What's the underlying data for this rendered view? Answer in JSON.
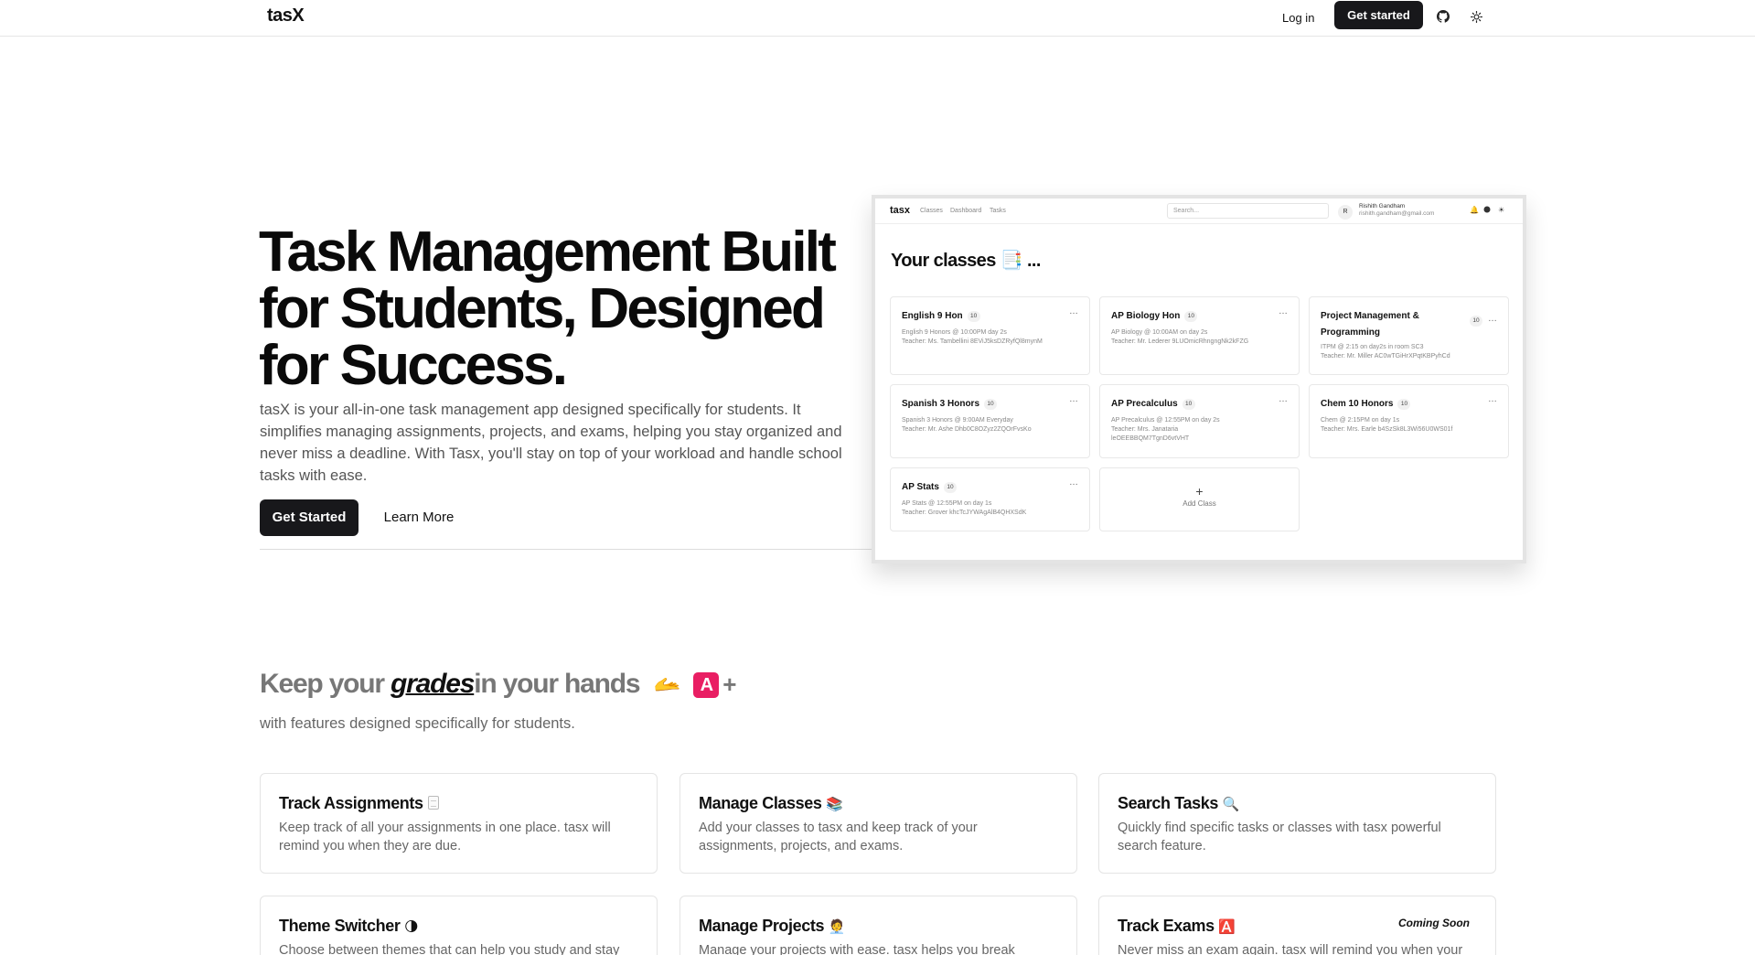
{
  "nav": {
    "brand": "tasX",
    "login": "Log in",
    "cta": "Get started",
    "icons": [
      "github-icon",
      "theme-sun-icon"
    ]
  },
  "hero": {
    "title": "Task Management Built for Students, Designed for Success.",
    "description": "tasX is your all-in-one task management app designed specifically for students. It simplifies managing assignments, projects, and exams, helping you stay organized and never miss a deadline. With Tasx, you'll stay on top of your workload and handle school tasks with ease.",
    "primary": "Get Started",
    "secondary": "Learn More"
  },
  "preview": {
    "brand": "tasx",
    "links": [
      "Classes",
      "Dashboard",
      "Tasks"
    ],
    "search_placeholder": "Search...",
    "avatar": "R",
    "user_name": "Rishith Gandham",
    "user_email": "rishith.gandham@gmail.com",
    "heading": "Your classes 📑 ...",
    "more": "…",
    "classes": [
      {
        "name": "English 9 Hon",
        "count": "10",
        "line1": "English 9 Honors @ 10:00PM day 2s",
        "line2": "Teacher: Ms. Tambellini 8EViJ5ksDZRyfQl8mynM"
      },
      {
        "name": "AP Biology Hon",
        "count": "10",
        "line1": "AP Biology @ 10:00AM on day 2s",
        "line2": "Teacher: Mr. Lederer 9LUOmicRhngngNk2kFZG"
      },
      {
        "name": "Project Management & Programming",
        "count": "10",
        "line1": "ITPM @ 2:15 on day2s in room SC3",
        "line2": "Teacher: Mr. Miller AC0wTGiHrXPqtKBPyhCd"
      },
      {
        "name": "Spanish 3 Honors",
        "count": "10",
        "line1": "Spanish 3 Honors @ 9:00AM Everyday",
        "line2": "Teacher: Mr. Ashe Dhb0C8OZyz2ZQOrFvsKo"
      },
      {
        "name": "AP Precalculus",
        "count": "10",
        "line1": "AP Precalculus @ 12:55PM on day 2s",
        "line2": "Teacher: Mrs. Janataria leOEEBBQM7TgnD6vtVHT"
      },
      {
        "name": "Chem 10 Honors",
        "count": "10",
        "line1": "Chem @ 2:15PM on day 1s",
        "line2": "Teacher: Mrs. Earle b4SzSk8L3Wi56U0WS01f"
      },
      {
        "name": "AP Stats",
        "count": "10",
        "line1": "AP Stats @ 12:55PM on day 1s",
        "line2": "Teacher: Grover khcTcJYWAgAlB4QHXSdK"
      }
    ],
    "add_class": "Add Class"
  },
  "features_section": {
    "title_pre": "Keep your",
    "title_em": "grades",
    "title_post": "in your hands",
    "emoji_hand": "🫴",
    "grade_letter": "A",
    "grade_plus": "+",
    "subtitle": "with features designed specifically for students."
  },
  "features": [
    {
      "title": "Track Assignments",
      "desc": "Keep track of all your assignments in one place. tasx will remind you when they are due.",
      "emoji": ""
    },
    {
      "title": "Manage Classes",
      "desc": "Add your classes to tasx and keep track of your assignments, projects, and exams.",
      "emoji": "📚"
    },
    {
      "title": "Search Tasks",
      "desc": "Quickly find specific tasks or classes with tasx powerful search feature.",
      "emoji": "🔍"
    },
    {
      "title": "Theme Switcher",
      "desc": "Choose between themes that can help you study and stay",
      "emoji": "🌗"
    },
    {
      "title": "Manage Projects",
      "desc": "Manage your projects with ease. tasx helps you break",
      "emoji": "🧑‍💼"
    },
    {
      "title": "Track Exams",
      "desc": "Never miss an exam again. tasx will remind you when your",
      "emoji": "🅰️",
      "badge": "Coming Soon"
    }
  ]
}
